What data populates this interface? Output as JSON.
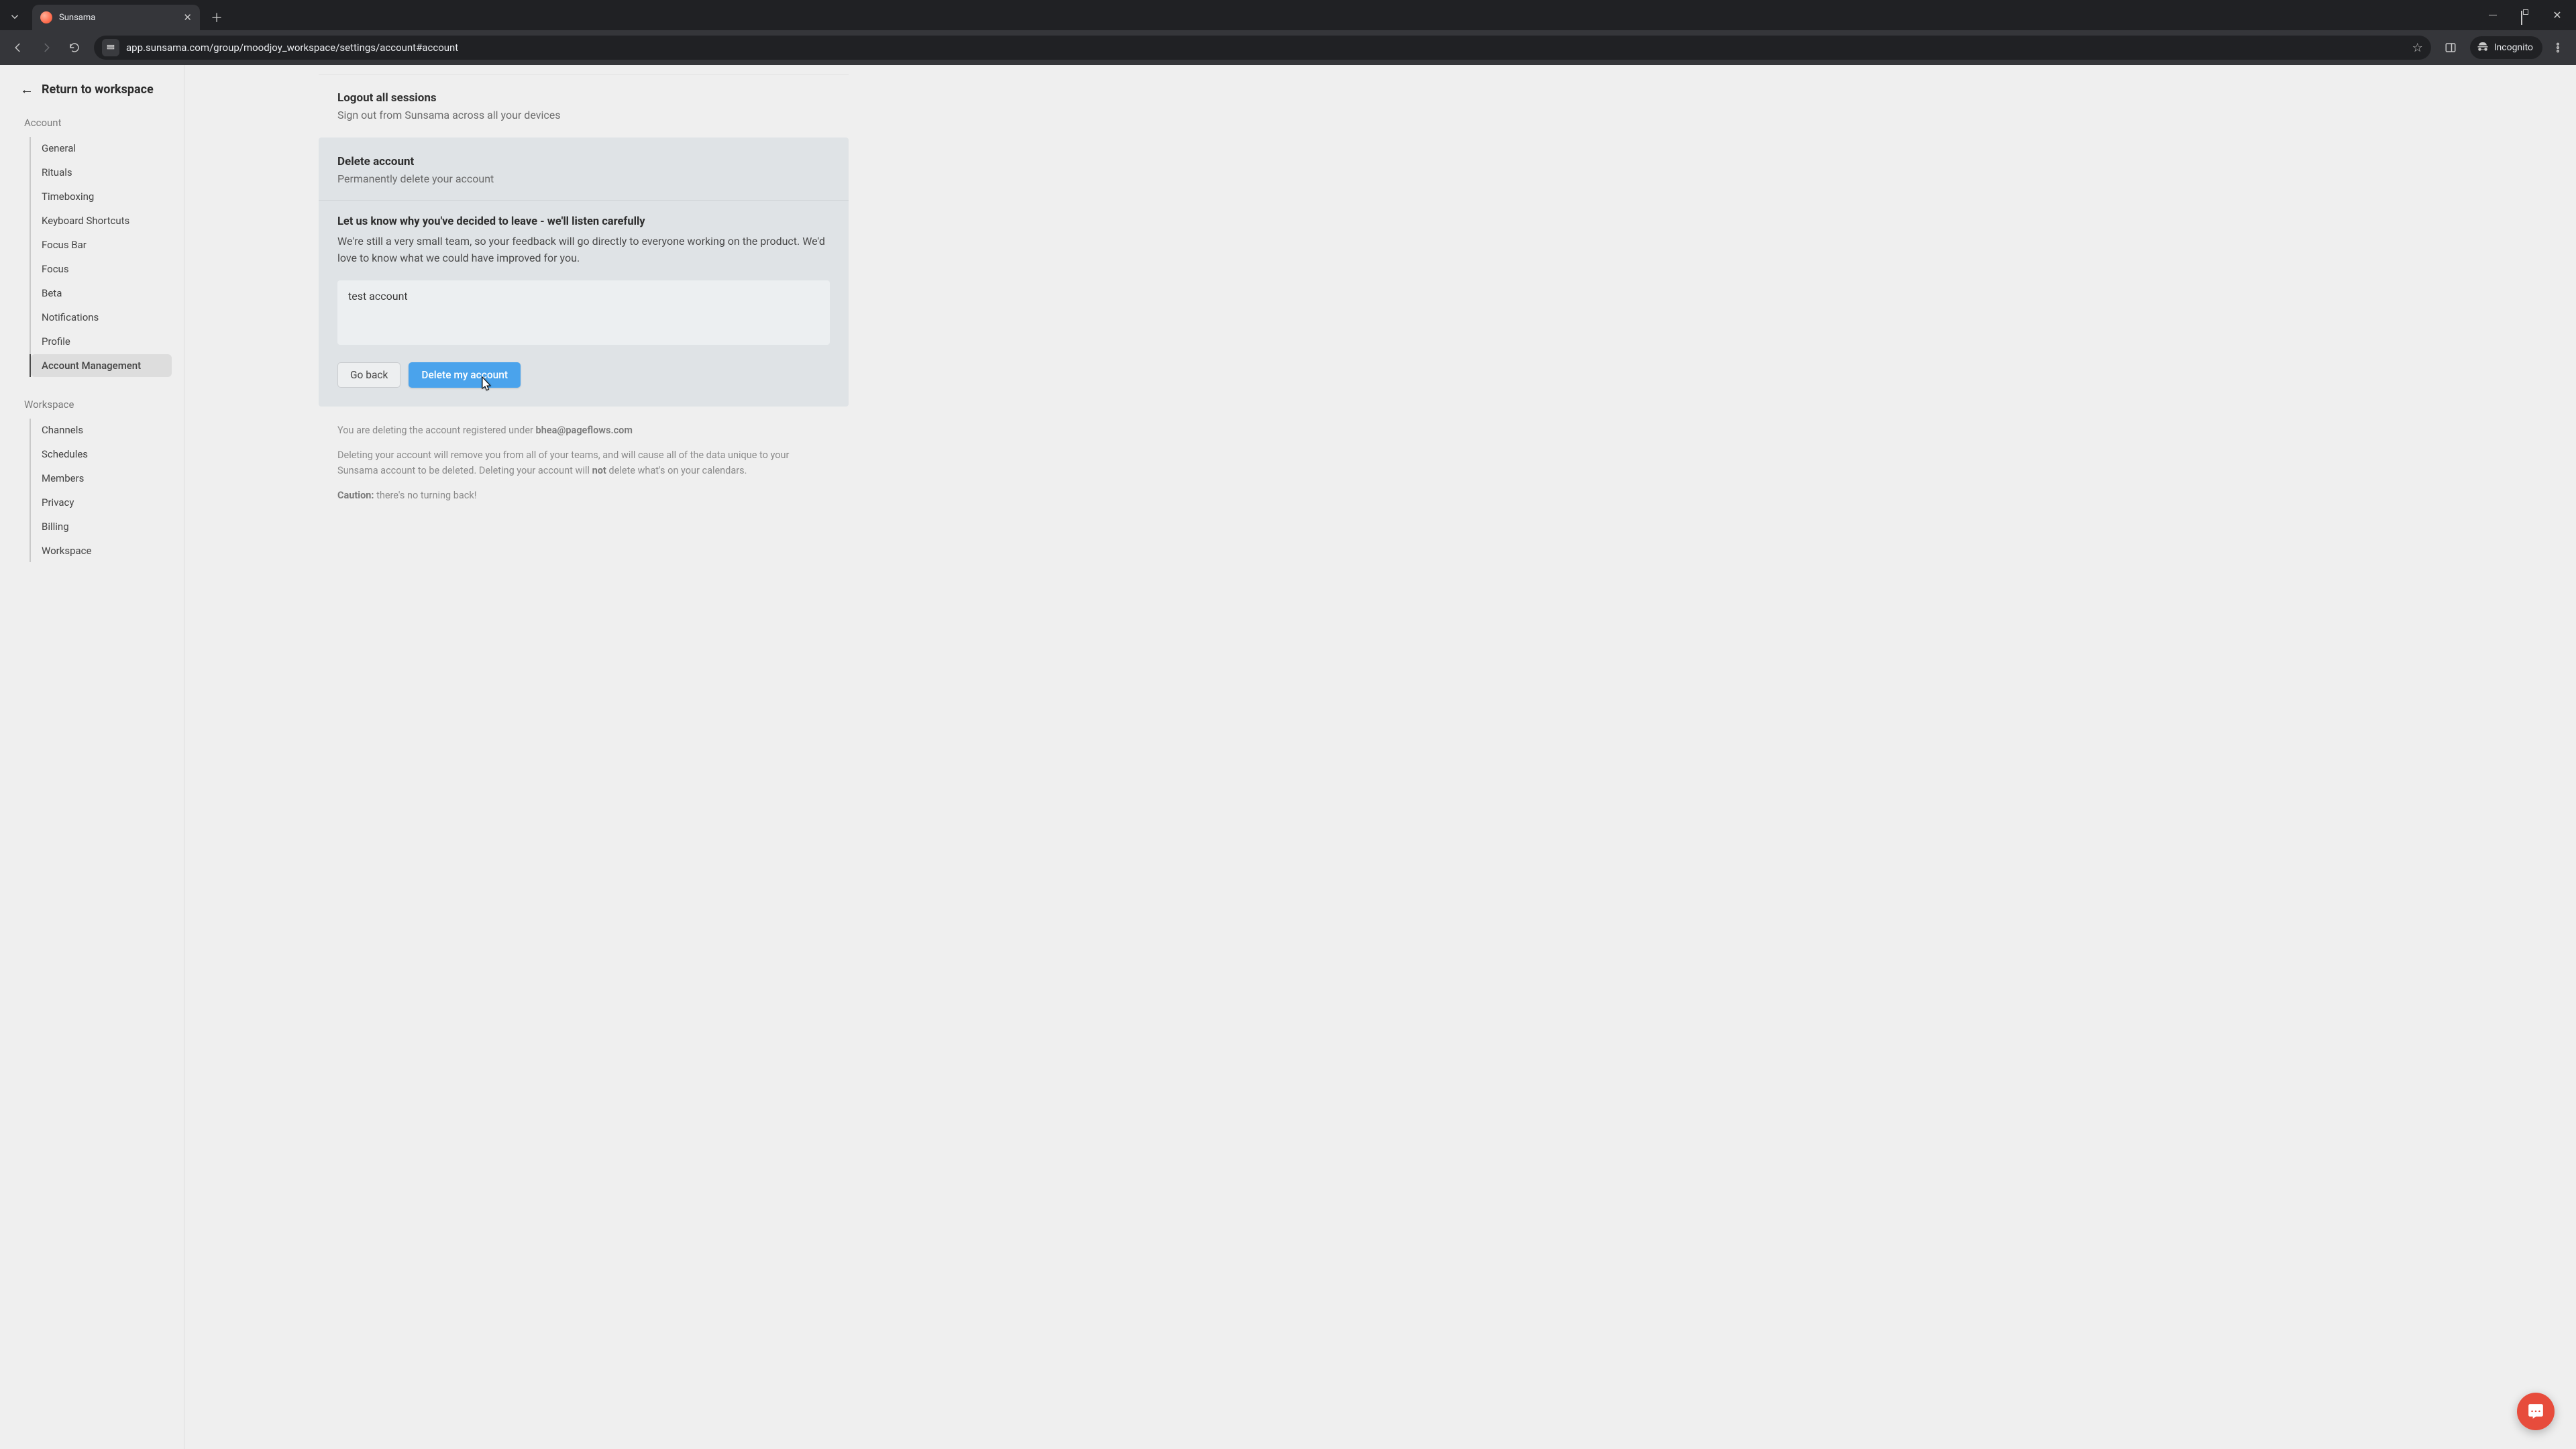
{
  "browser": {
    "tab_title": "Sunsama",
    "url": "app.sunsama.com/group/moodjoy_workspace/settings/account#account",
    "incognito_label": "Incognito"
  },
  "sidebar": {
    "return_label": "Return to workspace",
    "sections": {
      "account": {
        "label": "Account",
        "items": [
          "General",
          "Rituals",
          "Timeboxing",
          "Keyboard Shortcuts",
          "Focus Bar",
          "Focus",
          "Beta",
          "Notifications",
          "Profile",
          "Account Management"
        ],
        "active_index": 9
      },
      "workspace": {
        "label": "Workspace",
        "items": [
          "Channels",
          "Schedules",
          "Members",
          "Privacy",
          "Billing",
          "Workspace"
        ]
      }
    }
  },
  "logout_block": {
    "title": "Logout all sessions",
    "subtitle": "Sign out from Sunsama across all your devices"
  },
  "delete_block": {
    "title": "Delete account",
    "subtitle": "Permanently delete your account"
  },
  "feedback": {
    "title": "Let us know why you've decided to leave - we'll listen carefully",
    "desc": "We're still a very small team, so your feedback will go directly to everyone working on the product. We'd love to know what we could have improved for you.",
    "value": "test account",
    "go_back_label": "Go back",
    "delete_label": "Delete my account"
  },
  "fineprint": {
    "line1_pre": "You are deleting the account registered under ",
    "email": "bhea@pageflows.com",
    "line2_a": "Deleting your account will remove you from all of your teams, and will cause all of the data unique to your Sunsama account to be deleted. Deleting your account will ",
    "line2_strong": "not",
    "line2_b": " delete what's on your calendars.",
    "caution_label": "Caution:",
    "caution_text": " there's no turning back!"
  }
}
